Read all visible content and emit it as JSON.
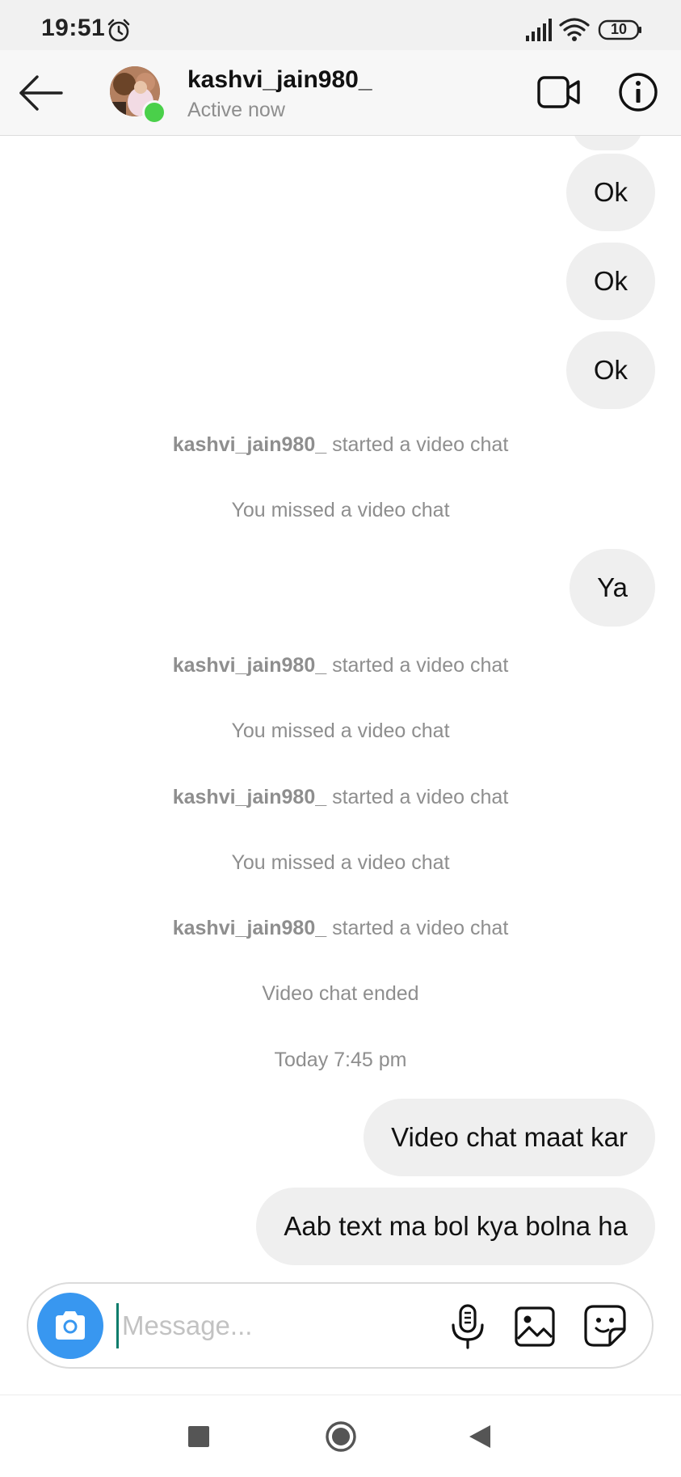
{
  "status_bar": {
    "time": "19:51",
    "battery": "10",
    "icons": [
      "alarm-icon",
      "signal-icon",
      "wifi-icon",
      "battery-icon"
    ]
  },
  "header": {
    "username": "kashvi_jain980_",
    "status": "Active now",
    "icons": [
      "back-arrow-icon",
      "video-camera-icon",
      "info-icon"
    ]
  },
  "messages": [
    {
      "type": "sent",
      "text": "Ok"
    },
    {
      "type": "sent",
      "text": "Ok"
    },
    {
      "type": "sent",
      "text": "Ok"
    },
    {
      "type": "system",
      "user": "kashvi_jain980_",
      "text": " started a video chat"
    },
    {
      "type": "system",
      "text": "You missed a video chat"
    },
    {
      "type": "sent",
      "text": "Ya"
    },
    {
      "type": "system",
      "user": "kashvi_jain980_",
      "text": " started a video chat"
    },
    {
      "type": "system",
      "text": "You missed a video chat"
    },
    {
      "type": "system",
      "user": "kashvi_jain980_",
      "text": " started a video chat"
    },
    {
      "type": "system",
      "text": "You missed a video chat"
    },
    {
      "type": "system",
      "user": "kashvi_jain980_",
      "text": " started a video chat"
    },
    {
      "type": "system",
      "text": "Video chat ended"
    },
    {
      "type": "timestamp",
      "text": "Today 7:45 pm"
    },
    {
      "type": "sent",
      "text": "Video chat maat kar"
    },
    {
      "type": "sent",
      "text": "Aab text ma bol kya bolna ha"
    }
  ],
  "composer": {
    "placeholder": "Message...",
    "value": "",
    "icons": [
      "camera-icon",
      "microphone-icon",
      "gallery-icon",
      "sticker-icon"
    ]
  },
  "nav_bar": {
    "icons": [
      "recents-icon",
      "home-icon",
      "back-icon"
    ]
  },
  "colors": {
    "bubble_bg": "#efefef",
    "accent_blue": "#3897f0",
    "online_green": "#4ad04a",
    "muted_text": "#8e8e8e"
  }
}
